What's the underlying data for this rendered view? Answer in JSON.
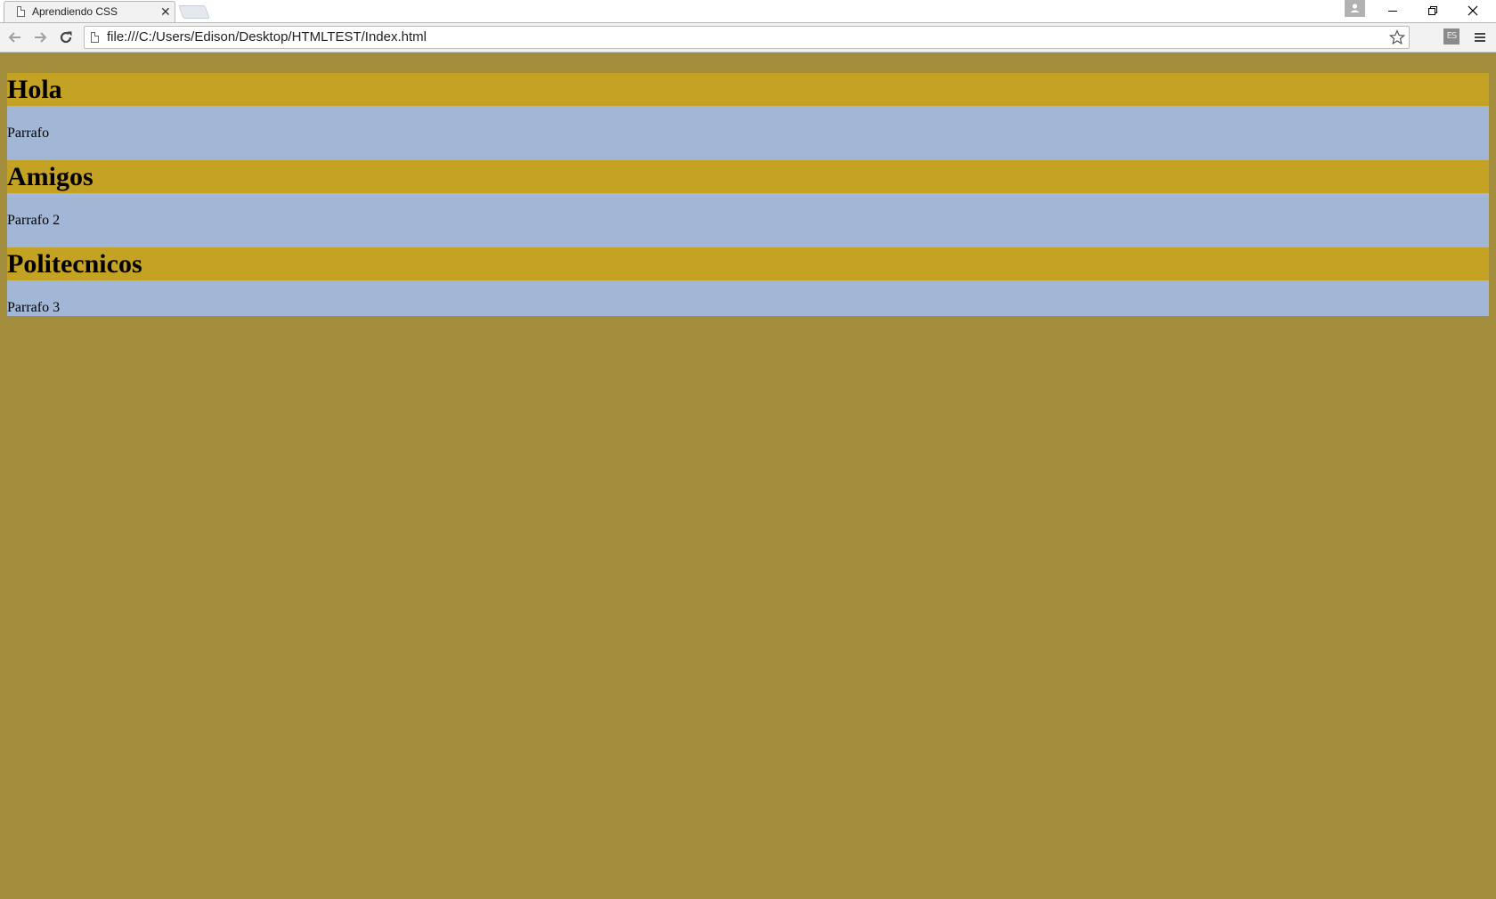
{
  "browser": {
    "tab_title": "Aprendiendo CSS",
    "tab_close": "✕",
    "address_url": "file:///C:/Users/Edison/Desktop/HTMLTEST/Index.html",
    "extension_label": "ES"
  },
  "page": {
    "background_color": "#a38e3e",
    "heading_color": "#c4a224",
    "paragraph_color": "#a2b6d6",
    "sections": [
      {
        "heading": "Hola",
        "paragraph": "Parrafo"
      },
      {
        "heading": "Amigos",
        "paragraph": "Parrafo 2"
      },
      {
        "heading": "Politecnicos",
        "paragraph": "Parrafo 3"
      }
    ]
  }
}
